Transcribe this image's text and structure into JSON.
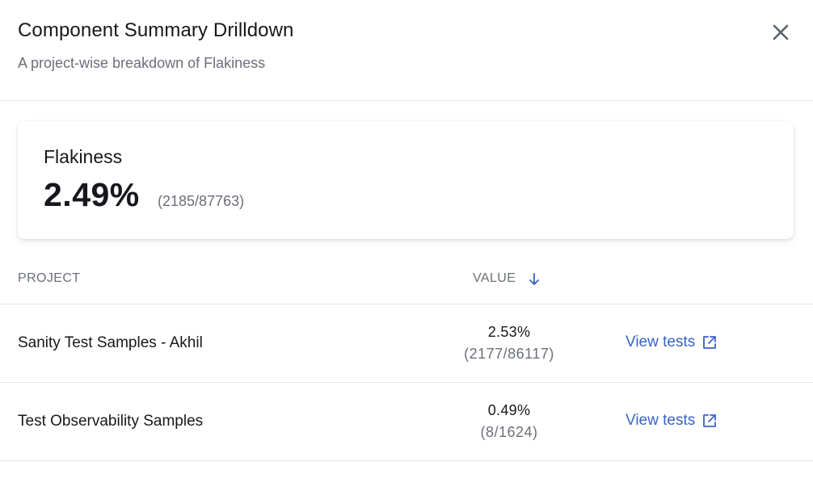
{
  "header": {
    "title": "Component Summary Drilldown",
    "subtitle": "A project-wise breakdown of Flakiness"
  },
  "summary": {
    "label": "Flakiness",
    "value": "2.49%",
    "ratio": "(2185/87763)"
  },
  "table": {
    "headers": {
      "project": "PROJECT",
      "value": "VALUE"
    },
    "rows": [
      {
        "project": "Sanity Test Samples - Akhil",
        "value": "2.53%",
        "ratio": "(2177/86117)",
        "link": "View tests"
      },
      {
        "project": "Test Observability Samples",
        "value": "0.49%",
        "ratio": "(8/1624)",
        "link": "View tests"
      }
    ]
  },
  "icons": {
    "close": "close-icon",
    "sort": "arrow-down-icon",
    "external": "external-link-icon"
  },
  "colors": {
    "link": "#3a62c9",
    "muted_text": "#6b6f78",
    "divider": "#e3e4e8"
  }
}
